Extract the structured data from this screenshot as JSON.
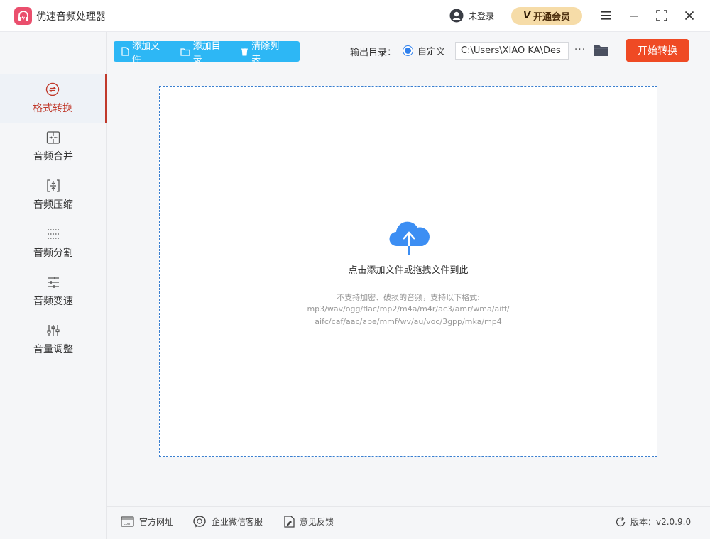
{
  "app": {
    "title": "优速音频处理器"
  },
  "user": {
    "login_label": "未登录"
  },
  "vip": {
    "badge": "V",
    "label": "开通会员"
  },
  "sidebar": {
    "items": [
      {
        "label": "格式转换",
        "icon": "convert-icon",
        "active": true
      },
      {
        "label": "音频合并",
        "icon": "merge-icon"
      },
      {
        "label": "音频压缩",
        "icon": "compress-icon"
      },
      {
        "label": "音频分割",
        "icon": "split-icon"
      },
      {
        "label": "音频变速",
        "icon": "speed-icon"
      },
      {
        "label": "音量调整",
        "icon": "volume-icon"
      }
    ]
  },
  "toolbar": {
    "add_file": "添加文件",
    "add_dir": "添加目录",
    "clear_list": "清除列表",
    "output_label": "输出目录：",
    "custom_option": "自定义",
    "output_path": "C:\\Users\\XIAO KA\\Des",
    "more": "···",
    "start": "开始转换"
  },
  "dropzone": {
    "main": "点击添加文件或拖拽文件到此",
    "note1": "不支持加密、破损的音频，支持以下格式:",
    "note2": "mp3/wav/ogg/flac/mp2/m4a/m4r/ac3/amr/wma/aiff/",
    "note3": "aifc/caf/aac/ape/mmf/wv/au/voc/3gpp/mka/mp4"
  },
  "footer": {
    "website": "官方网址",
    "wechat": "企业微信客服",
    "feedback": "意见反馈",
    "version": "版本：v2.0.9.0"
  },
  "colors": {
    "accent_blue": "#2db7f5",
    "start_red": "#ef4a24",
    "active_red": "#c0392b",
    "logo_pink": "#ea4f6d"
  }
}
